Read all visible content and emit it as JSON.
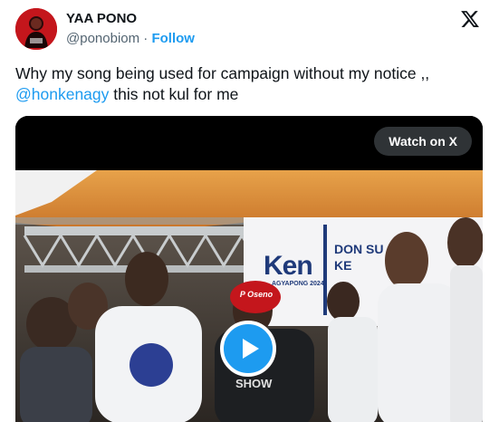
{
  "author": {
    "display_name": "YAA PONO",
    "handle": "@ponobiom",
    "separator": "·",
    "follow_label": "Follow"
  },
  "tweet": {
    "text_before": "Why my song being used for campaign without my notice ,, ",
    "mention": "@honkenagy",
    "text_after": " this not kul for me"
  },
  "media": {
    "watch_label": "Watch on X",
    "banner": {
      "ken": "Ken",
      "sub": "AGYAPONG 2024",
      "right_text": "DON SU KE"
    },
    "overlay_logo": "P Oseno",
    "shirt_text": "SHOW"
  },
  "colors": {
    "accent": "#1d9bf0",
    "brand_red": "#c4161c",
    "ken_red": "#d4202a",
    "ken_navy": "#1f3a7a"
  },
  "icons": {
    "brand": "x-logo-icon",
    "play": "play-icon"
  }
}
